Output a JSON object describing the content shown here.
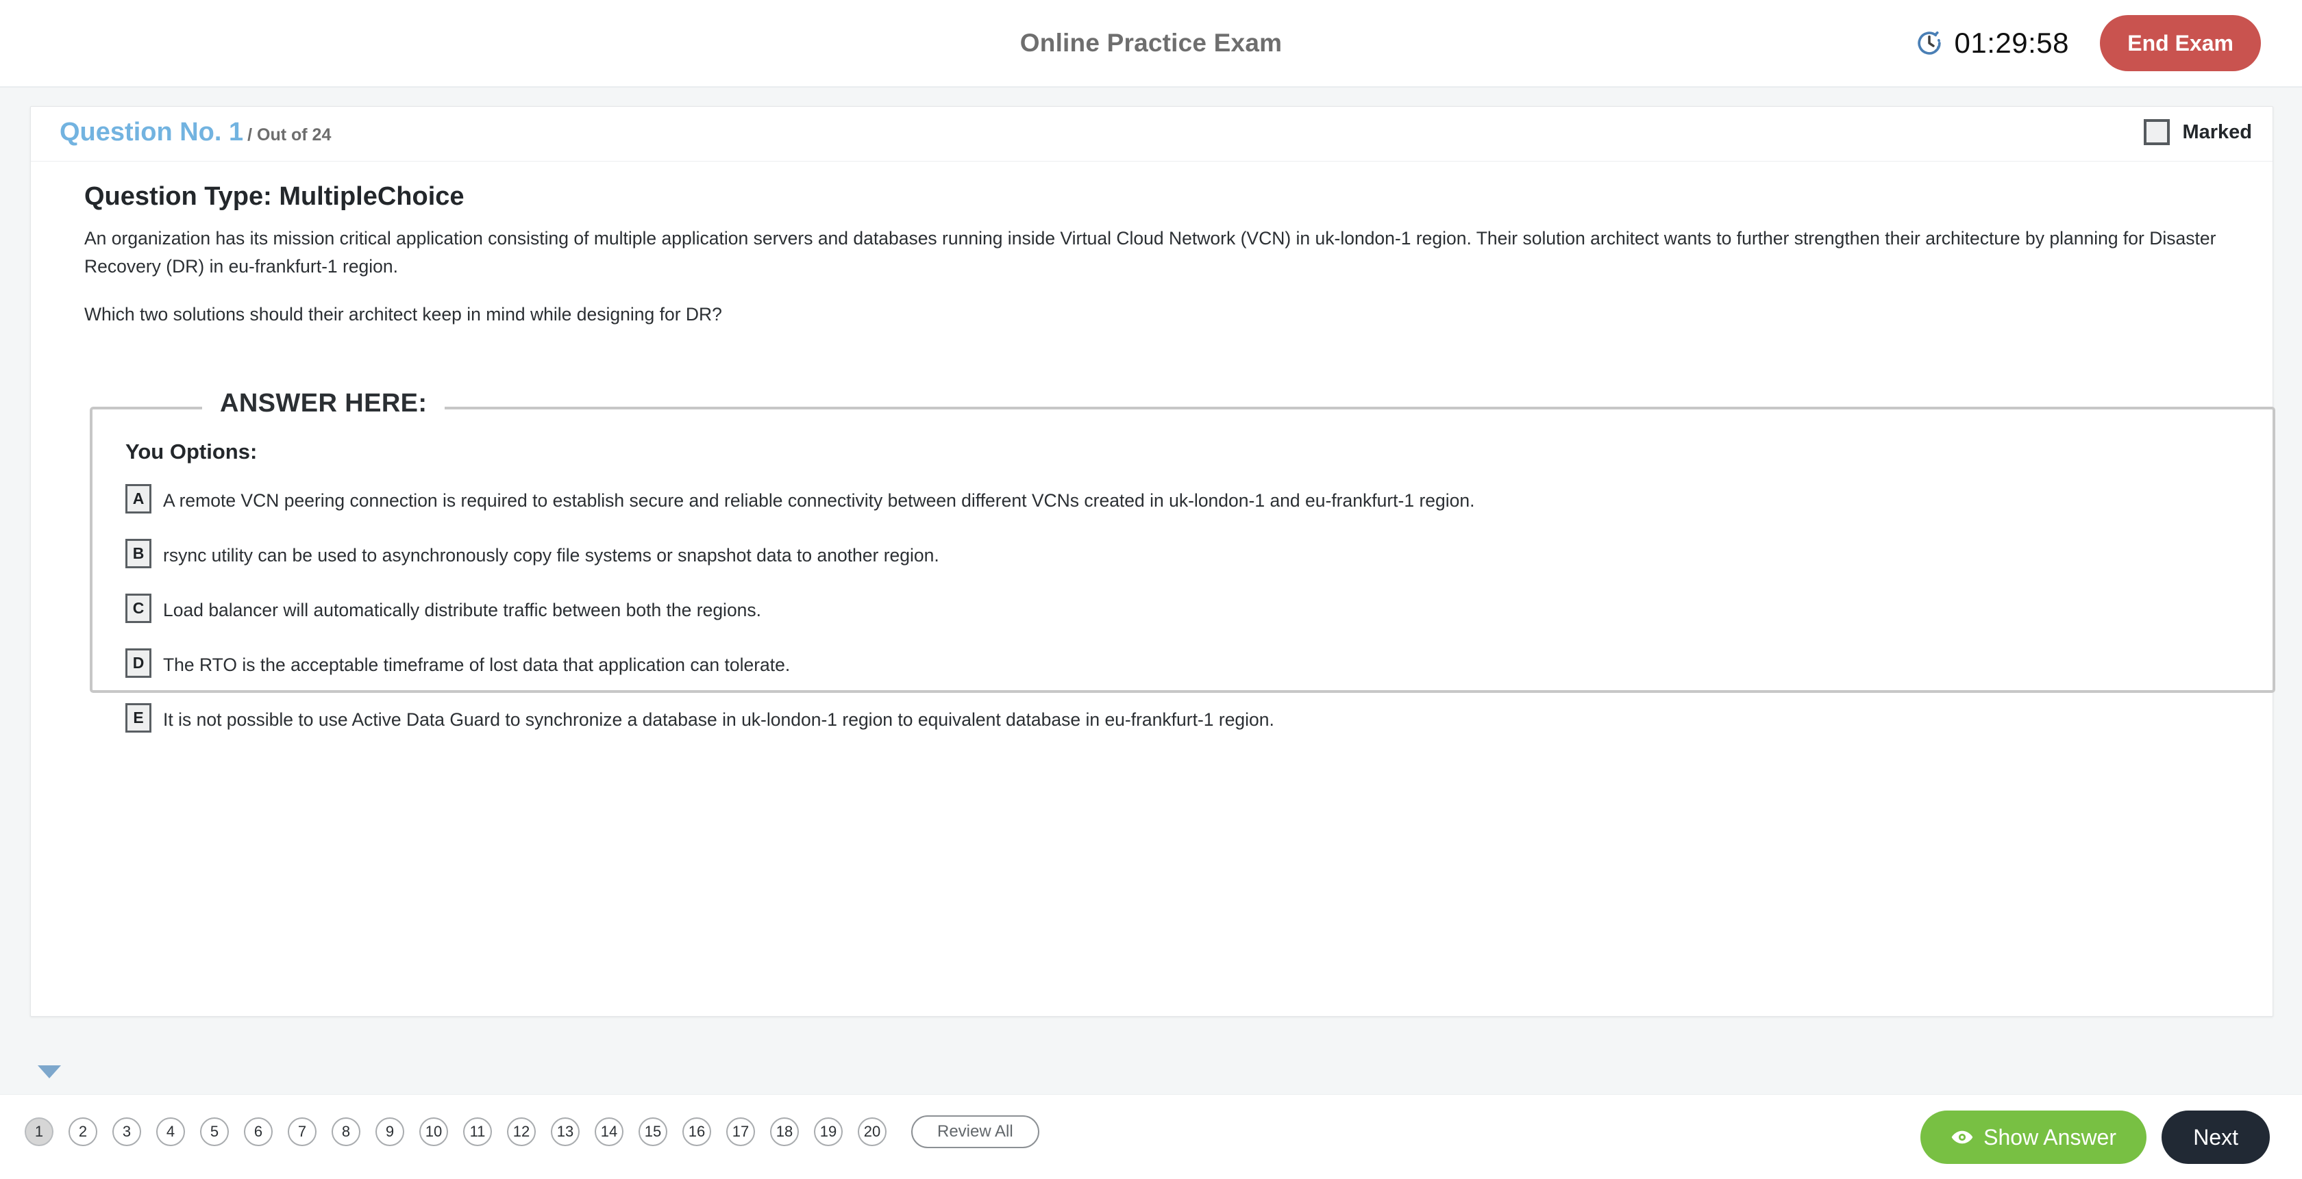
{
  "header": {
    "title": "Online Practice Exam",
    "clock_icon": "clock-icon",
    "timer": "01:29:58",
    "end_exam_label": "End Exam",
    "end_exam_color": "#c9534f"
  },
  "question": {
    "number_label": "Question No. 1",
    "out_of_label": "/ Out of 24",
    "number_color": "#72b3e0",
    "marked_label": "Marked",
    "type_label": "Question Type: MultipleChoice",
    "paragraphs": [
      "An organization has its mission critical application consisting of multiple application servers and databases running inside Virtual Cloud Network (VCN) in uk-london-1 region. Their solution architect wants to further strengthen their architecture by planning for Disaster Recovery (DR) in eu-frankfurt-1 region.",
      "Which two solutions should their architect keep in mind while designing for DR?"
    ],
    "answer_legend": "ANSWER HERE:",
    "options_title": "You Options:",
    "options": [
      {
        "letter": "A",
        "text": "A remote VCN peering connection is required to establish secure and reliable connectivity between different VCNs created in uk-london-1 and eu-frankfurt-1 region."
      },
      {
        "letter": "B",
        "text": "rsync utility can be used to asynchronously copy file systems or snapshot data to another region."
      },
      {
        "letter": "C",
        "text": "Load balancer will automatically distribute traffic between both the regions."
      },
      {
        "letter": "D",
        "text": "The RTO is the acceptable timeframe of lost data that application can tolerate."
      },
      {
        "letter": "E",
        "text": "It is not possible to use Active Data Guard to synchronize a database in uk-london-1 region to equivalent database in eu-frankfurt-1 region."
      }
    ]
  },
  "footer": {
    "pages": [
      "1",
      "2",
      "3",
      "4",
      "5",
      "6",
      "7",
      "8",
      "9",
      "10",
      "11",
      "12",
      "13",
      "14",
      "15",
      "16",
      "17",
      "18",
      "19",
      "20"
    ],
    "active_page": "1",
    "review_all_label": "Review All",
    "show_answer_label": "Show Answer",
    "show_answer_icon": "eye-icon",
    "show_answer_color": "#78c043",
    "next_label": "Next",
    "next_color": "#212934",
    "scroll_down_icon": "triangle-down-icon",
    "scroll_up_icon": "triangle-up-icon"
  }
}
